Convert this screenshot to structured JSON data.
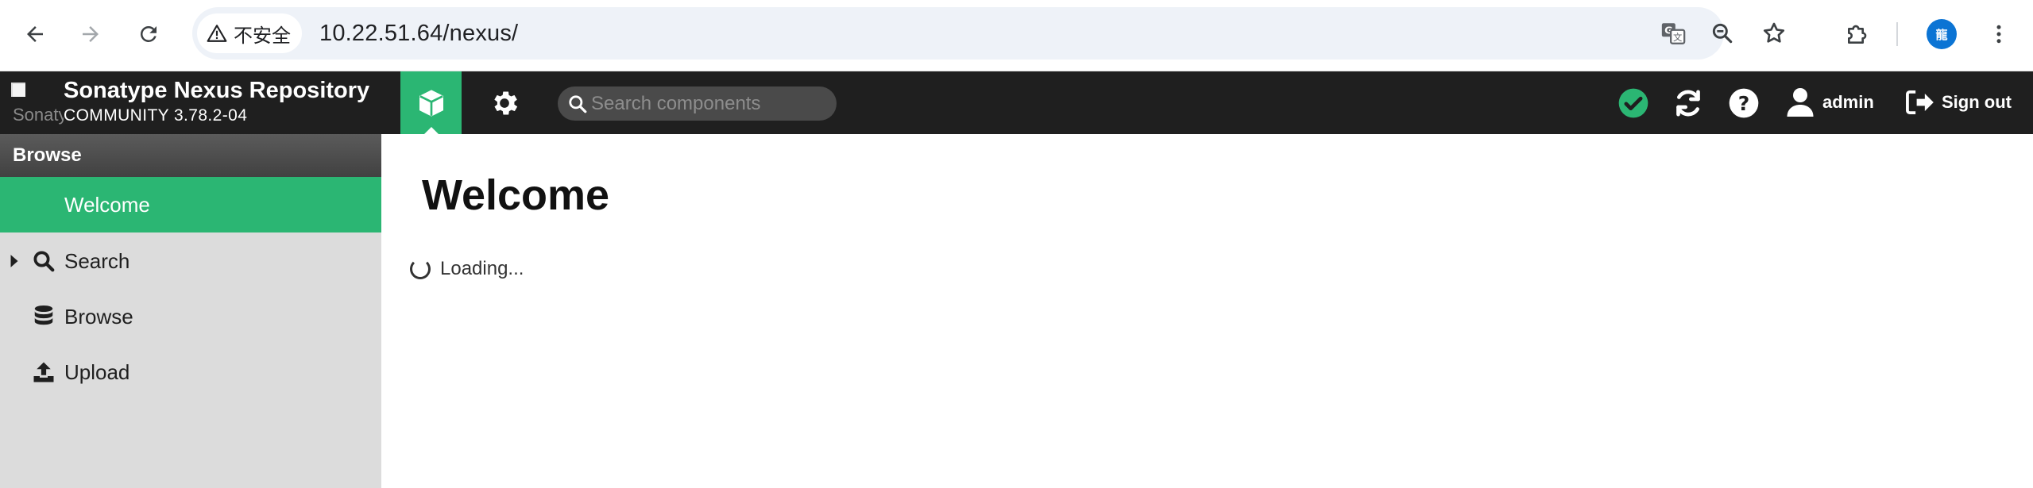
{
  "browser": {
    "security_label": "不安全",
    "url": "10.22.51.64/nexus/",
    "profile_initial": "龍",
    "icons": {
      "back": "arrow-left-icon",
      "forward": "arrow-right-icon",
      "reload": "reload-icon",
      "warning": "warning-triangle-icon",
      "translate": "translate-icon",
      "zoom": "zoom-out-icon",
      "bookmark": "star-icon",
      "extensions": "puzzle-icon",
      "menu": "kebab-menu-icon"
    }
  },
  "header": {
    "logo_alt": "Sonatype",
    "product_name": "Sonatype Nexus Repository",
    "edition": "COMMUNITY 3.78.2-04",
    "search_placeholder": "Search components",
    "user_name": "admin",
    "sign_out_label": "Sign out",
    "icons": {
      "browse_mode": "cube-icon",
      "admin_mode": "gear-icon",
      "search": "search-icon",
      "health": "check-circle-icon",
      "refresh": "refresh-icon",
      "help": "question-circle-icon",
      "user": "user-icon",
      "sign_out": "sign-out-icon"
    }
  },
  "sidebar": {
    "section_title": "Browse",
    "items": [
      {
        "label": "Welcome",
        "active": true,
        "icon": ""
      },
      {
        "label": "Search",
        "active": false,
        "icon": "search-icon",
        "expandable": true
      },
      {
        "label": "Browse",
        "active": false,
        "icon": "database-icon"
      },
      {
        "label": "Upload",
        "active": false,
        "icon": "upload-icon"
      }
    ]
  },
  "main": {
    "title": "Welcome",
    "loading_text": "Loading..."
  },
  "colors": {
    "accent_green": "#2bb673",
    "header_bg": "#1f1f1f",
    "sidebar_bg": "#dcdcdc",
    "omnibox_bg": "#eef2f8",
    "profile_blue": "#0b74d4"
  }
}
